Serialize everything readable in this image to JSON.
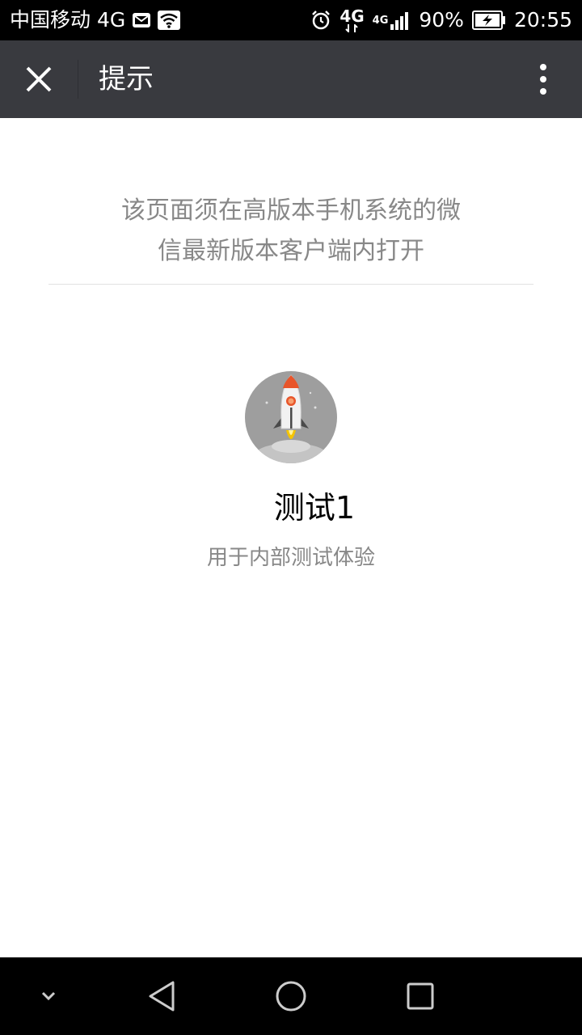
{
  "status_bar": {
    "carrier": "中国移动 4G",
    "network_label_1": "4G",
    "network_label_2": "4G",
    "battery": "90%",
    "time": "20:55",
    "icons": [
      "mail-icon",
      "wifi-icon",
      "alarm-icon",
      "signal-icon",
      "battery-charging-icon"
    ]
  },
  "header": {
    "title": "提示",
    "close_icon": "close-icon",
    "more_icon": "more-vertical-icon"
  },
  "notice": {
    "line1": "该页面须在高版本手机系统的微",
    "line2": "信最新版本客户端内打开"
  },
  "app": {
    "logo_icon": "rocket-icon",
    "name": "测试1",
    "description": "用于内部测试体验"
  },
  "nav_bar": {
    "icons": [
      "hide-keyboard-icon",
      "back-icon",
      "home-icon",
      "recents-icon"
    ]
  },
  "colors": {
    "status_bar_bg": "#000000",
    "title_bar_bg": "#393a3f",
    "page_bg": "#ffffff",
    "secondary_text": "#888888",
    "rocket_accent": "#e8552a"
  }
}
